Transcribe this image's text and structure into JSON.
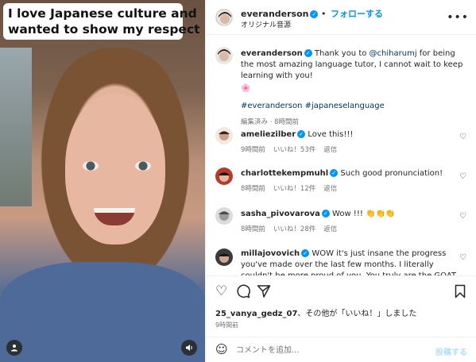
{
  "media": {
    "caption_line1": "I love Japanese culture and",
    "caption_line2": "wanted to show my respect"
  },
  "header": {
    "username": "everanderson",
    "follow_label": "フォローする",
    "audio_label": "オリジナル音源",
    "separator": "•",
    "more_icon": "more-horizontal-icon"
  },
  "post": {
    "username": "everanderson",
    "text_before": "Thank you to ",
    "mention": "@chiharumj",
    "text_after": " for being the most amazing language tutor, I cannot wait to keep learning with you!",
    "emoji": "🌸",
    "hashtags": "#everanderson #japaneselanguage",
    "edited": "編集済み · 8時間前"
  },
  "comments": [
    {
      "username": "ameliezilber",
      "text": "Love this!!!",
      "time": "9時間前",
      "likes": "いいね！53件",
      "reply": "返信"
    },
    {
      "username": "charlottekempmuhl",
      "text": "Such good pronunciation!",
      "time": "8時間前",
      "likes": "いいね！12件",
      "reply": "返信"
    },
    {
      "username": "sasha_pivovarova",
      "text": "Wow !!! 👏👏👏",
      "time": "8時間前",
      "likes": "いいね！28件",
      "reply": "返信"
    },
    {
      "username": "millajovovich",
      "text": "WOW it's just insane the progress you've made over the last few months. I literally couldn't be more proud of you. You truly are the GOAT👏👏👏👏👏👏👏",
      "time": "",
      "likes": "",
      "reply": ""
    }
  ],
  "actions": {
    "liked_by_user": "25_vanya_gedz_07",
    "liked_by_text": "、その他が「いいね！」しました",
    "liked_by_bold2": "その他",
    "time": "9時間前"
  },
  "composer": {
    "placeholder": "コメントを追加...",
    "post_label": "投稿する"
  },
  "colors": {
    "link": "#0095f6",
    "tag": "#00376b",
    "muted": "#737373",
    "post_disabled": "#b2dffc"
  }
}
